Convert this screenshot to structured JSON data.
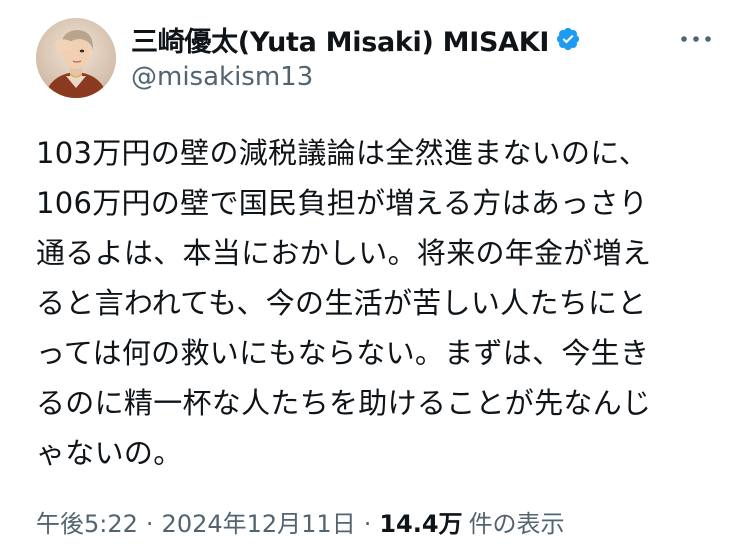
{
  "author": {
    "display_name": "三崎優太(Yuta Misaki) MISAKI",
    "handle": "@misakism13",
    "verified": true,
    "verified_icon": "verified-badge-icon",
    "avatar_icon": "profile-avatar"
  },
  "more_icon": "more-options-icon",
  "tweet": {
    "lines": [
      "103万円の壁の減税議論は全然進まないのに、",
      "106万円の壁で国民負担が増える方はあっさり",
      "通るよは、本当におかしい。将来の年金が増え",
      "ると言われても、今の生活が苦しい人たちにと",
      "っては何の救いにもならない。まずは、今生き",
      "るのに精一杯な人たちを助けることが先なんじ",
      "ゃないの。"
    ]
  },
  "meta": {
    "time": "午後5:22",
    "separator": "·",
    "date": "2024年12月11日",
    "views_count": "14.4万",
    "views_label": "件の表示"
  },
  "colors": {
    "text": "#0f1419",
    "secondary": "#536471",
    "verified": "#1d9bf0",
    "background": "#ffffff"
  }
}
